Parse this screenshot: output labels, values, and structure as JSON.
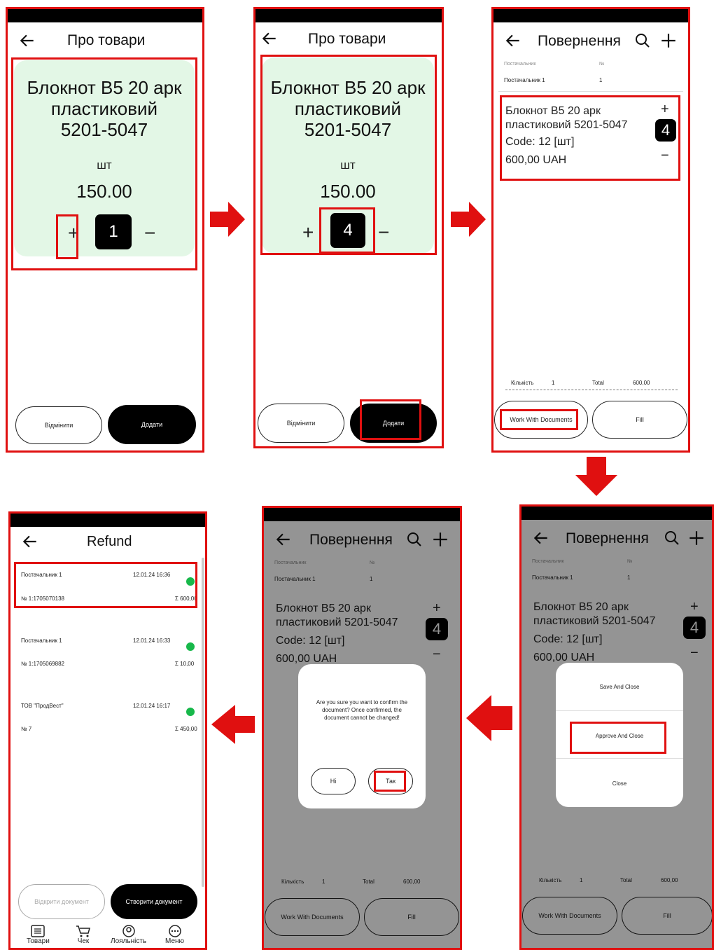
{
  "colors": {
    "highlight": "#e01010",
    "card": "#e3f7e6",
    "status": "#17b84a",
    "overlay": "#00000066"
  },
  "icons": {
    "back": "arrow-left-icon",
    "search": "search-icon",
    "add": "plus-icon",
    "arrow": "red-arrow-icon"
  },
  "product": {
    "name_l1": "Блокнот В5 20 арк",
    "name_l2": "пластиковий",
    "name_l3": "5201-5047",
    "unit": "шт",
    "price": "150.00",
    "plus": "+",
    "minus": "−"
  },
  "s1": {
    "title": "Про товари",
    "qty": "1",
    "cancel": "Відмінити",
    "add": "Додати"
  },
  "s2": {
    "title": "Про товари",
    "qty": "4",
    "cancel": "Відмінити",
    "add": "Додати"
  },
  "doc": {
    "title": "Повернення",
    "supplier_label": "Постачальник",
    "no_label": "№",
    "supplier": "Постачальник 1",
    "no": "1",
    "item_l1": "Блокнот В5 20 арк",
    "item_l2": "пластиковий 5201-5047",
    "code": "Code: 12 [шт]",
    "amount": "600,00 UAH",
    "qty": "4",
    "count_label": "Кількість",
    "count": "1",
    "total_label": "Total",
    "total": "600,00",
    "work": "Work With Documents",
    "fill": "Fill"
  },
  "menu": {
    "save": "Save And Close",
    "approve": "Approve And Close",
    "close": "Close"
  },
  "confirm": {
    "msg1": "Are you sure you want to confirm the",
    "msg2": "document? Once confirmed, the",
    "msg3": "document cannot be changed!",
    "no": "Ні",
    "yes": "Так"
  },
  "refund": {
    "title": "Refund",
    "rows": [
      {
        "supplier": "Постачальник 1",
        "date": "12.01.24 16:36",
        "no": "№ 1:1705070138",
        "sum": "Σ 600,00"
      },
      {
        "supplier": "Постачальник 1",
        "date": "12.01.24 16:33",
        "no": "№ 1:1705069882",
        "sum": "Σ 10,00"
      },
      {
        "supplier": "ТОВ \"ПродВест\"",
        "date": "12.01.24 16:17",
        "no": "№ 7",
        "sum": "Σ 450,00"
      }
    ],
    "open": "Відкрити документ",
    "create": "Створити документ",
    "nav": [
      "Товари",
      "Чек",
      "Лояльність",
      "Меню"
    ]
  }
}
